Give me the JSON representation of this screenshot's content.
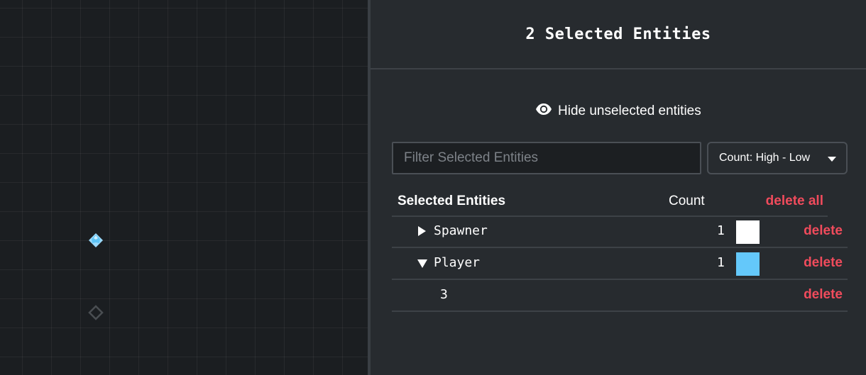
{
  "colors": {
    "accent_delete": "#f04b5c",
    "player_color": "#64c8fa",
    "spawner_color": "#ffffff"
  },
  "canvas": {
    "entities": [
      {
        "type": "player",
        "icon": "player-entity-icon"
      },
      {
        "type": "spawner",
        "icon": "spawner-entity-icon"
      }
    ]
  },
  "panel": {
    "title": "2 Selected Entities",
    "toggle_label": "Hide unselected entities",
    "toggle_icon": "eye-icon",
    "filter": {
      "placeholder": "Filter Selected Entities",
      "value": ""
    },
    "sort": {
      "selected": "Count: High - Low"
    },
    "table": {
      "headers": {
        "name": "Selected Entities",
        "count": "Count",
        "delete_all": "delete all"
      },
      "rows": [
        {
          "name": "Spawner",
          "expanded": false,
          "count": "1",
          "color": "#ffffff",
          "delete": "delete"
        },
        {
          "name": "Player",
          "expanded": true,
          "count": "1",
          "color": "#64c8fa",
          "delete": "delete"
        },
        {
          "name": "3",
          "sub": true,
          "delete": "delete"
        }
      ]
    }
  }
}
